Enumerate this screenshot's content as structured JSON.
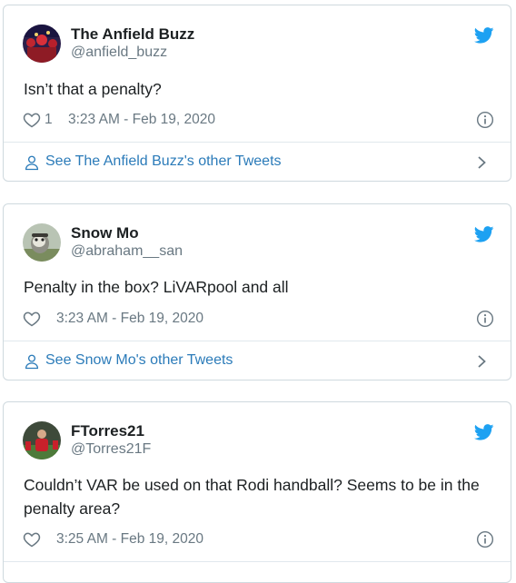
{
  "tweets": [
    {
      "name": "The Anfield Buzz",
      "handle": "@anfield_buzz",
      "text": "Isn’t that a penalty?",
      "likes": "1",
      "time": "3:23 AM - Feb 19, 2020",
      "footer_link": "See The Anfield Buzz's other Tweets"
    },
    {
      "name": "Snow Mo",
      "handle": "@abraham__san",
      "text": "Penalty in the box? LiVARpool and all",
      "likes": "",
      "time": "3:23 AM - Feb 19, 2020",
      "footer_link": "See Snow Mo's other Tweets"
    },
    {
      "name": "FTorres21",
      "handle": "@Torres21F",
      "text": "Couldn’t VAR be used on that Rodi handball? Seems to be in the penalty area?",
      "likes": "",
      "time": "3:25 AM - Feb 19, 2020"
    }
  ],
  "icons": {
    "bird": "twitter-bird-icon",
    "heart": "heart-icon",
    "info": "info-icon",
    "person": "person-icon",
    "chevron": "chevron-right-icon"
  },
  "colors": {
    "bird": "#1da1f2",
    "link": "#2b7bb9",
    "muted": "#697882",
    "border": "#cfd9de"
  }
}
